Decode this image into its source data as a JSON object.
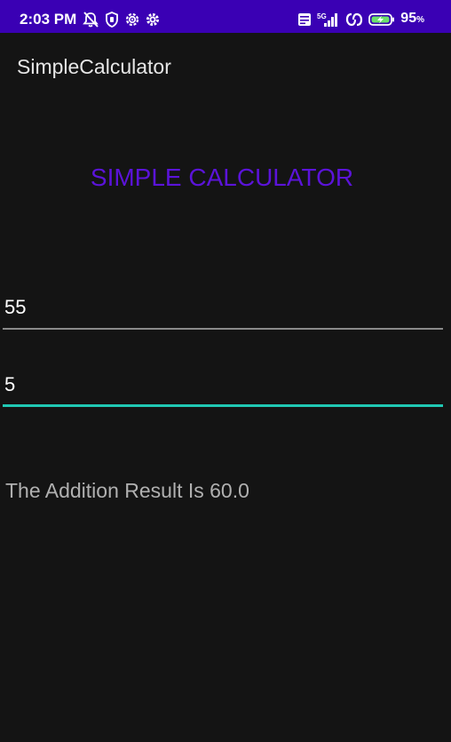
{
  "status_bar": {
    "time": "2:03 PM",
    "battery_percent": "95",
    "battery_suffix": "%",
    "network": "5G",
    "left_icons": [
      "notifications-off-icon",
      "shield-hand-icon",
      "settings-gear-icon",
      "settings-cog-icon"
    ],
    "right_icons": [
      "volte-icon",
      "signal-icon",
      "hotspot-icon",
      "battery-charging-icon"
    ]
  },
  "app_bar": {
    "title": "SimpleCalculator"
  },
  "main": {
    "heading": "SIMPLE CALCULATOR",
    "first_number": "55",
    "second_number": "5",
    "result_text": "The Addition Result Is 60.0"
  },
  "colors": {
    "status_bar_bg": "#3a00b4",
    "background": "#141414",
    "heading": "#5b13d9",
    "focused_underline": "#20c8b4",
    "unfocused_underline": "#8a8a8a",
    "result_text": "#b0b0b0"
  }
}
